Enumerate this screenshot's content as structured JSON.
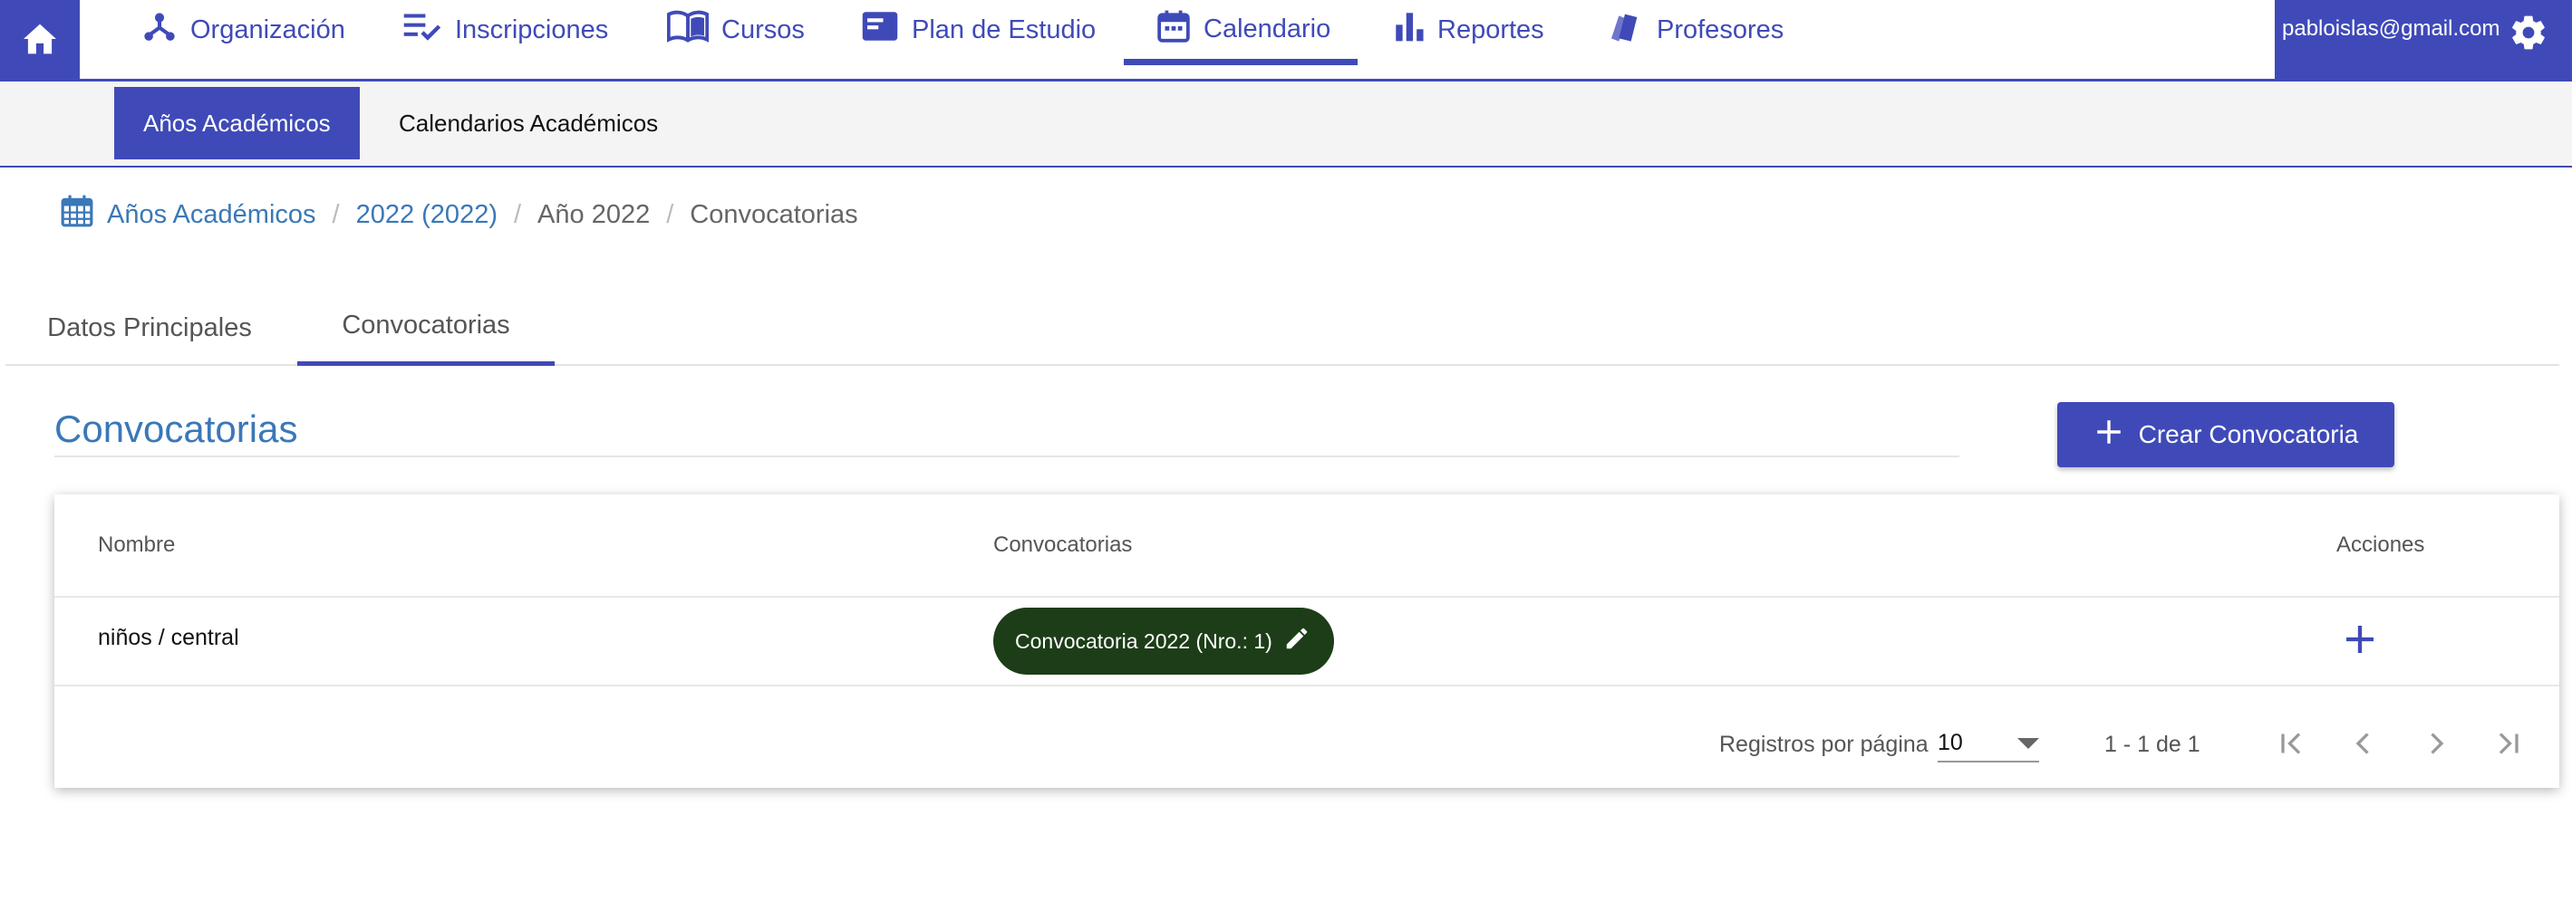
{
  "nav": {
    "items": [
      {
        "label": "Organización",
        "icon": "organization-icon"
      },
      {
        "label": "Inscripciones",
        "icon": "checklist-icon"
      },
      {
        "label": "Cursos",
        "icon": "book-icon"
      },
      {
        "label": "Plan de Estudio",
        "icon": "plan-icon"
      },
      {
        "label": "Calendario",
        "icon": "calendar-icon"
      },
      {
        "label": "Reportes",
        "icon": "bar-chart-icon"
      },
      {
        "label": "Profesores",
        "icon": "cards-icon"
      }
    ],
    "active": "Calendario",
    "user_email": "pabloislas@gmail.com"
  },
  "subnav": {
    "tabs": [
      "Años Académicos",
      "Calendarios Académicos"
    ],
    "active": "Años Académicos"
  },
  "breadcrumb": [
    "Años Académicos",
    "2022 (2022)",
    "Año 2022",
    "Convocatorias"
  ],
  "tabs": {
    "items": [
      "Datos Principales",
      "Convocatorias"
    ],
    "active": "Convocatorias"
  },
  "section": {
    "title": "Convocatorias",
    "create_button": "Crear Convocatoria"
  },
  "table": {
    "columns": [
      "Nombre",
      "Convocatorias",
      "Acciones"
    ],
    "rows": [
      {
        "nombre": "niños / central",
        "convocatoria": "Convocatoria 2022 (Nro.: 1)"
      }
    ]
  },
  "paginator": {
    "label": "Registros por página",
    "page_size": "10",
    "range": "1 - 1 de 1"
  },
  "colors": {
    "primary": "#3f4ab8",
    "link": "#3a78b8",
    "chip": "#1d3d18"
  }
}
